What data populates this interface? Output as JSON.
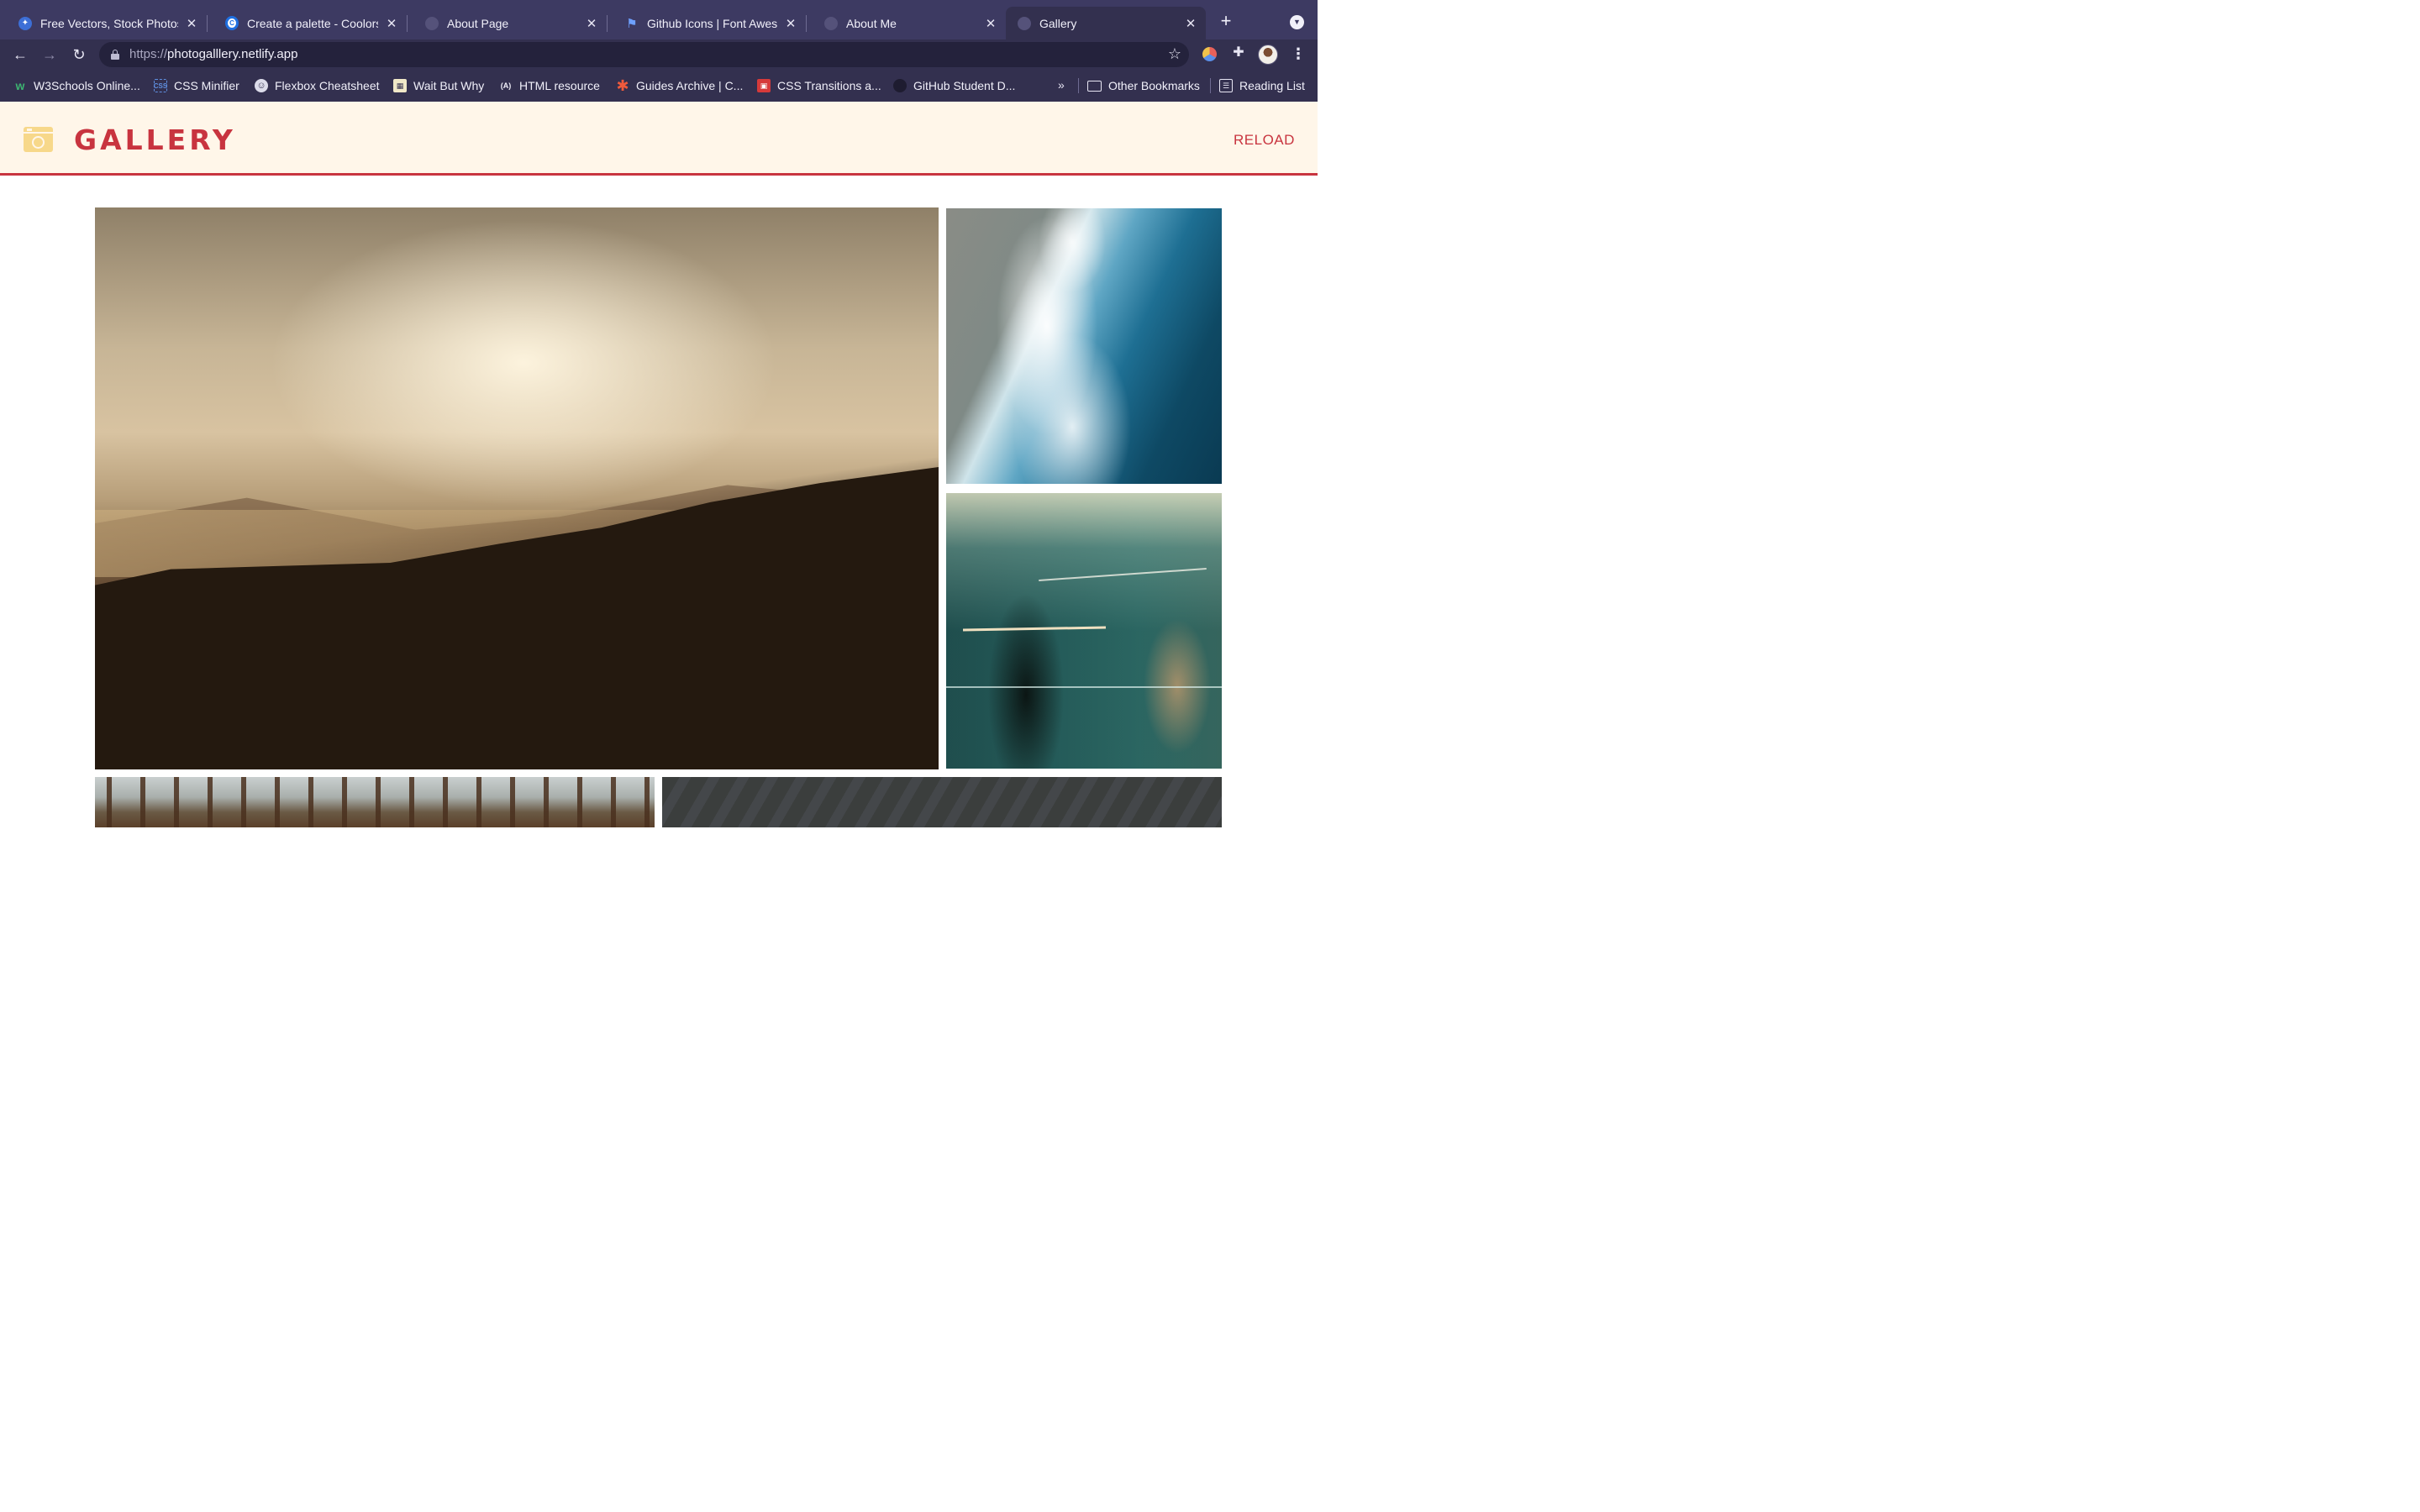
{
  "browser": {
    "tabs": [
      {
        "label": "Free Vectors, Stock Photos",
        "active": false,
        "favicon": "freepik-icon"
      },
      {
        "label": "Create a palette - Coolors",
        "active": false,
        "favicon": "coolors-icon"
      },
      {
        "label": "About Page",
        "active": false,
        "favicon": "globe-icon"
      },
      {
        "label": "Github Icons | Font Awesome",
        "active": false,
        "favicon": "flag-icon"
      },
      {
        "label": "About Me",
        "active": false,
        "favicon": "globe-icon"
      },
      {
        "label": "Gallery",
        "active": true,
        "favicon": "globe-icon"
      }
    ],
    "address": {
      "scheme": "https://",
      "host": "photogalllery.netlify.app"
    },
    "bookmarks": [
      {
        "label": "W3Schools Online...",
        "icon": "w3schools-icon"
      },
      {
        "label": "CSS Minifier",
        "icon": "css-icon"
      },
      {
        "label": "Flexbox Cheatsheet",
        "icon": "flexbox-icon"
      },
      {
        "label": "Wait But Why",
        "icon": "waitbutwhy-icon"
      },
      {
        "label": "HTML resource",
        "icon": "html-icon"
      },
      {
        "label": "Guides Archive | C...",
        "icon": "asterisk-icon"
      },
      {
        "label": "CSS Transitions a...",
        "icon": "robot-icon"
      },
      {
        "label": "GitHub Student D...",
        "icon": "github-icon"
      }
    ],
    "bookmarks_overflow": "»",
    "other_bookmarks": "Other Bookmarks",
    "reading_list": "Reading List"
  },
  "site": {
    "title": "GALLERY",
    "reload_label": "RELOAD",
    "colors": {
      "accent": "#c8343f",
      "header_bg": "#fff6e9",
      "logo": "#f7d88a"
    }
  },
  "gallery": {
    "photos": [
      {
        "name": "misty-sunset-hills"
      },
      {
        "name": "ocean-waves-aerial"
      },
      {
        "name": "abstract-teal-art"
      },
      {
        "name": "pine-forest"
      },
      {
        "name": "dark-texture"
      }
    ]
  }
}
